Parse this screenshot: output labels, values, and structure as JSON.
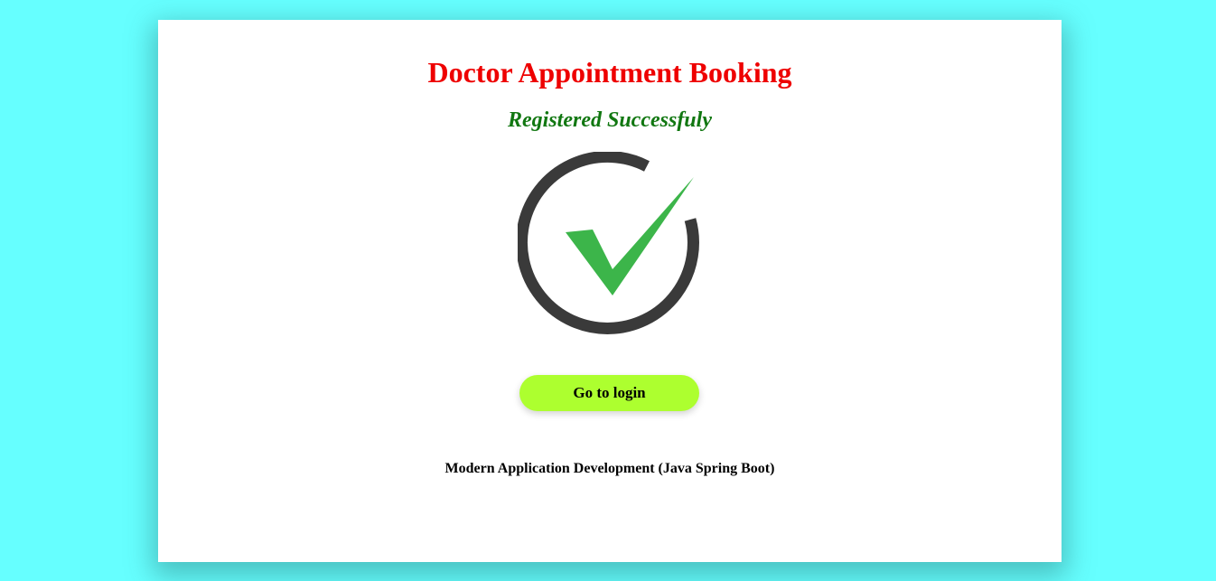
{
  "page": {
    "title": "Doctor Appointment Booking",
    "status_message": "Registered Successfuly",
    "login_button_label": "Go to login",
    "footer_text": "Modern Application Development (Java Spring Boot)"
  },
  "icons": {
    "success": "checkmark-circle-icon"
  },
  "colors": {
    "background": "#66ffff",
    "title": "#ee0000",
    "status": "#117711",
    "button": "#adff2f",
    "check": "#3cb54a",
    "ring": "#3a3a3a"
  }
}
